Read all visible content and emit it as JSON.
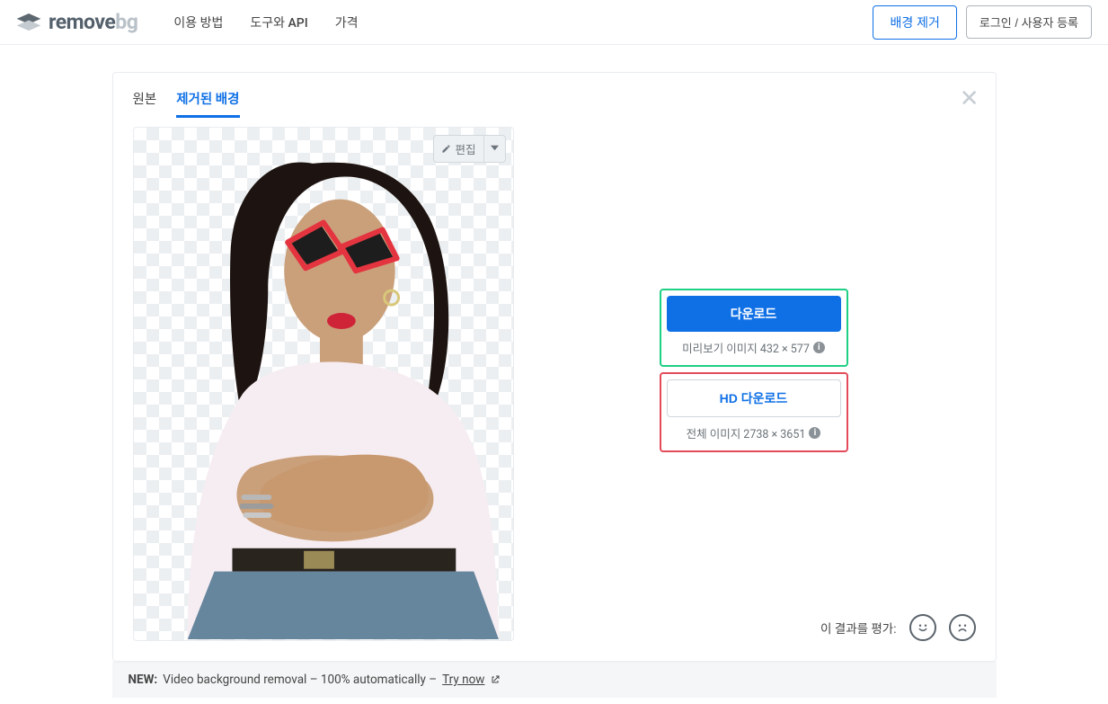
{
  "brand": {
    "name_main": "remove",
    "name_suffix": "bg"
  },
  "nav": {
    "howto": "이용 방법",
    "tools": "도구와 API",
    "pricing": "가격"
  },
  "header": {
    "remove_bg": "배경 제거",
    "login": "로그인 / 사용자 등록"
  },
  "tabs": {
    "original": "원본",
    "removed": "제거된 배경"
  },
  "editor": {
    "edit_label": "편집"
  },
  "download": {
    "preview_btn": "다운로드",
    "preview_meta": "미리보기 이미지 432 × 577",
    "hd_btn": "HD 다운로드",
    "hd_meta": "전체 이미지 2738 × 3651"
  },
  "rating": {
    "prompt": "이 결과를 평가:"
  },
  "banner": {
    "new_label": "NEW:",
    "text": "Video background removal – 100% automatically –",
    "cta": "Try now"
  }
}
